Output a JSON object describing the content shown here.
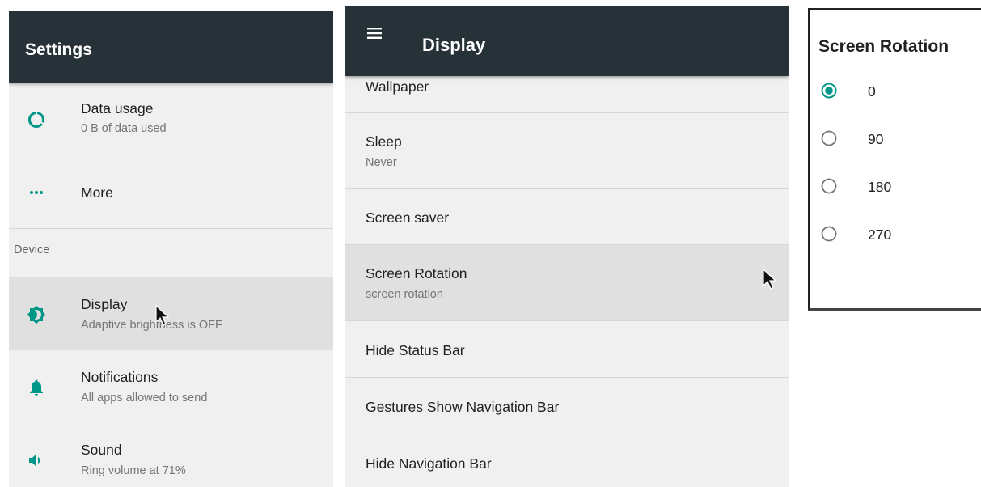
{
  "settings_panel": {
    "title": "Settings",
    "items": [
      {
        "title": "Data usage",
        "subtitle": "0 B of data used",
        "icon": "data-usage-icon"
      },
      {
        "title": "More",
        "icon": "more-dots-icon"
      }
    ],
    "section_header": "Device",
    "device_items": [
      {
        "title": "Display",
        "subtitle": "Adaptive brightness is OFF",
        "icon": "brightness-icon"
      },
      {
        "title": "Notifications",
        "subtitle": "All apps allowed to send",
        "icon": "bell-icon"
      },
      {
        "title": "Sound",
        "subtitle": "Ring volume at 71%",
        "icon": "volume-icon"
      }
    ]
  },
  "display_panel": {
    "title": "Display",
    "menu_icon": "hamburger-menu-icon",
    "items": [
      {
        "title": "Wallpaper"
      },
      {
        "title": "Sleep",
        "subtitle": "Never"
      },
      {
        "title": "Screen saver"
      },
      {
        "title": "Screen Rotation",
        "subtitle": "screen rotation"
      },
      {
        "title": "Hide Status Bar"
      },
      {
        "title": "Gestures Show Navigation Bar"
      },
      {
        "title": "Hide Navigation Bar"
      }
    ]
  },
  "rotation_dialog": {
    "title": "Screen Rotation",
    "options": [
      "0",
      "90",
      "180",
      "270"
    ],
    "selected": "0"
  },
  "colors": {
    "appbar": "#263238",
    "accent": "#009688",
    "background": "#f0f0f0",
    "highlight": "#e0e0e0"
  }
}
